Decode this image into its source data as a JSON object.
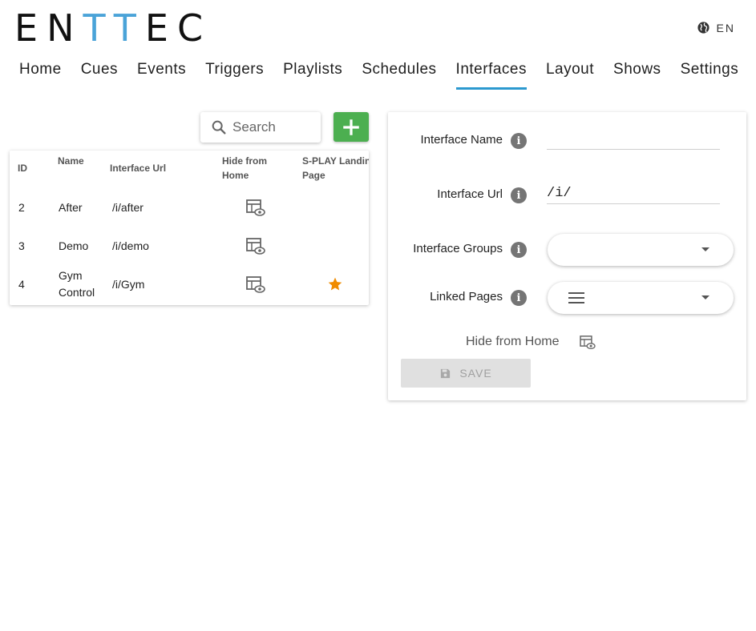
{
  "logo": {
    "text_left": "EN",
    "text_mid": "TT",
    "text_right": "EC"
  },
  "language": {
    "label": "EN",
    "icon": "globe-icon"
  },
  "nav": {
    "tabs": [
      {
        "label": "Home"
      },
      {
        "label": "Cues"
      },
      {
        "label": "Events"
      },
      {
        "label": "Triggers"
      },
      {
        "label": "Playlists"
      },
      {
        "label": "Schedules"
      },
      {
        "label": "Interfaces",
        "active": true
      },
      {
        "label": "Layout"
      },
      {
        "label": "Shows"
      },
      {
        "label": "Settings"
      }
    ]
  },
  "search": {
    "placeholder": "Search",
    "value": ""
  },
  "table": {
    "headers": {
      "id": "ID",
      "name": "Name",
      "url": "Interface Url",
      "hide_line1": "Hide from",
      "hide_line2": "Home",
      "landing_line1": "S-PLAY Landing",
      "landing_line2": "Page"
    },
    "rows": [
      {
        "id": "2",
        "name_line1": "After",
        "name_line2": "",
        "url": "/i/after",
        "hide_icon": "table-eye-icon",
        "landing": false
      },
      {
        "id": "3",
        "name_line1": "Demo",
        "name_line2": "",
        "url": "/i/demo",
        "hide_icon": "table-eye-icon",
        "landing": false
      },
      {
        "id": "4",
        "name_line1": "Gym",
        "name_line2": "Control",
        "url": "/i/Gym",
        "hide_icon": "table-eye-icon",
        "landing": true
      }
    ]
  },
  "form": {
    "name_label": "Interface Name",
    "name_value": "",
    "url_label": "Interface Url",
    "url_value": "/i/",
    "groups_label": "Interface Groups",
    "pages_label": "Linked Pages",
    "hide_label": "Hide from Home",
    "save_label": "SAVE"
  },
  "colors": {
    "accent_blue": "#2c99cf",
    "logo_blue": "#4aa3d8",
    "add_green": "#4caf50",
    "star_orange": "#f08c00"
  }
}
